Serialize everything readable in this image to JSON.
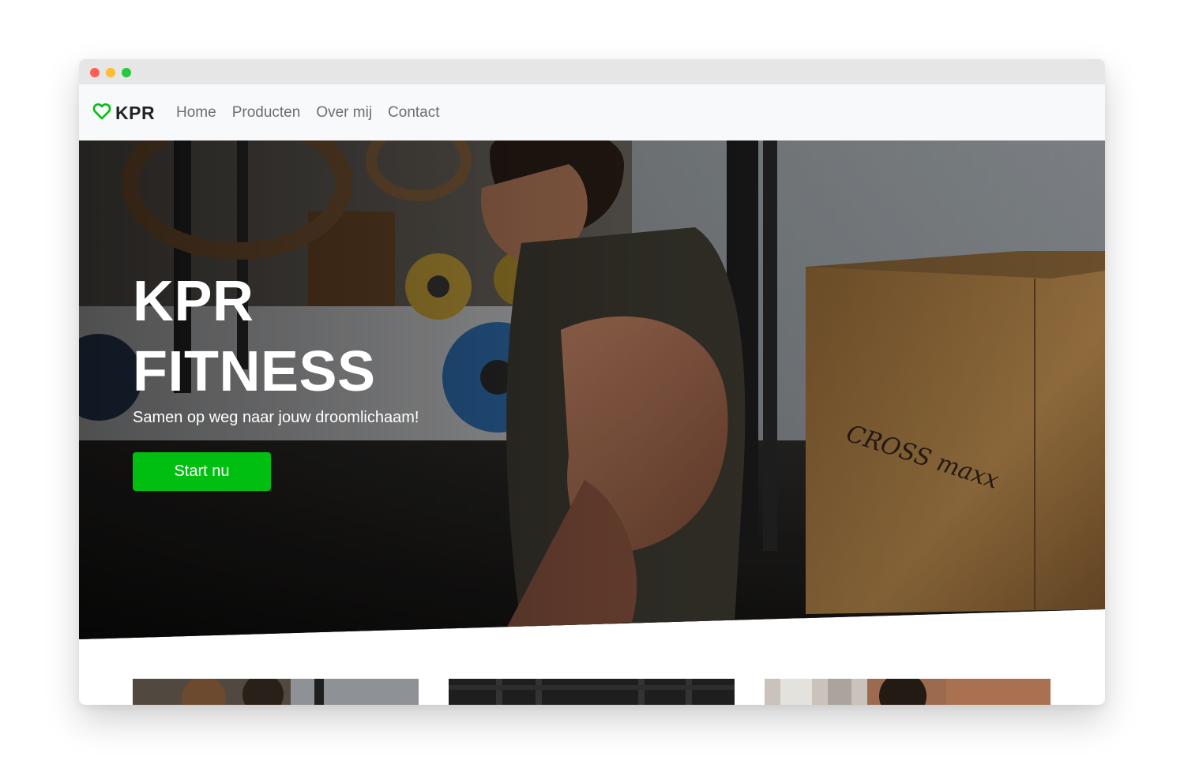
{
  "browser": {
    "controls": [
      "close",
      "minimize",
      "maximize"
    ]
  },
  "navbar": {
    "brand": "KPR",
    "brand_icon": "heart-outline-icon",
    "brand_color": "#00bf10",
    "links": [
      "Home",
      "Producten",
      "Over mij",
      "Contact"
    ]
  },
  "hero": {
    "title_line1": "KPR",
    "title_line2": "FITNESS",
    "subtitle": "Samen op weg naar jouw droomlichaam!",
    "cta_label": "Start nu",
    "cta_color": "#00bf10",
    "box_brand_text": "CROSS maxx"
  },
  "cards": [
    {
      "name": "card-image-1"
    },
    {
      "name": "card-image-2"
    },
    {
      "name": "card-image-3"
    }
  ]
}
